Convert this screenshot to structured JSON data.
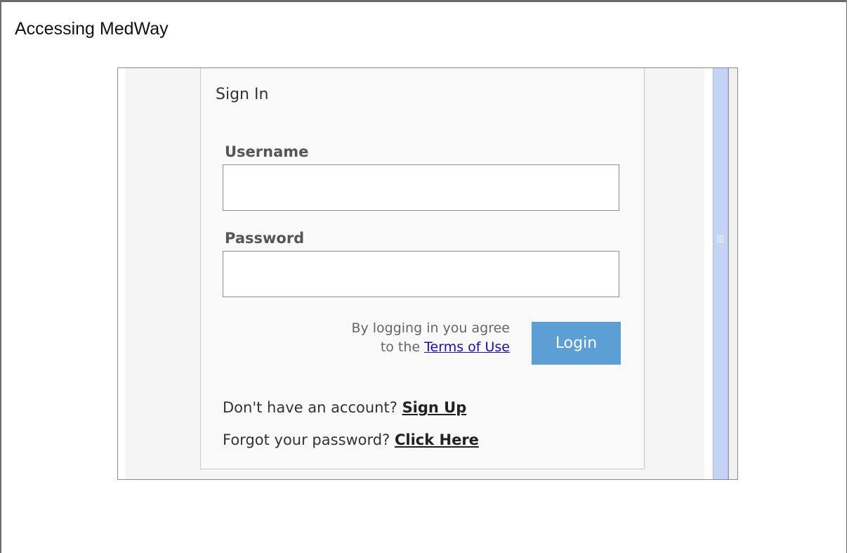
{
  "document": {
    "title": "Accessing MedWay"
  },
  "signin": {
    "heading": "Sign In",
    "username_label": "Username",
    "username_value": "",
    "password_label": "Password",
    "password_value": "",
    "terms_prefix": "By logging in you agree",
    "terms_middle": "to the",
    "terms_link": "Terms of Use",
    "login_button": "Login",
    "signup_prompt": "Don't have an account?",
    "signup_link": "Sign Up",
    "forgot_prompt": "Forgot your password?",
    "forgot_link": "Click Here"
  },
  "colors": {
    "login_button": "#5c9fd4",
    "scrollbar": "#c4d4f6",
    "link": "#1a0dab"
  }
}
